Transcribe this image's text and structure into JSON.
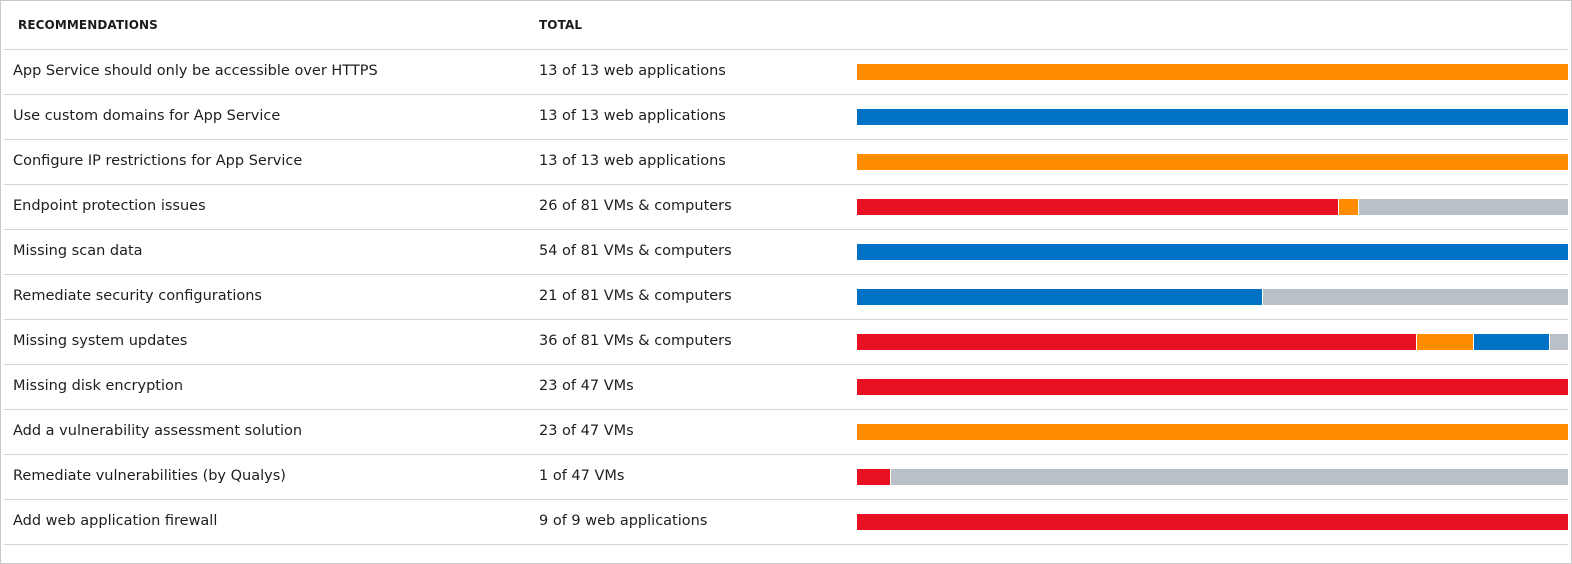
{
  "colors": {
    "high": "#e81123",
    "medium": "#ff8c00",
    "low": "#0072c6",
    "healthy": "#bac0c7"
  },
  "header": {
    "recommendations": "RECOMMENDATIONS",
    "total": "TOTAL"
  },
  "rows": [
    {
      "name": "App Service should only be accessible over HTTPS",
      "total": "13 of 13 web applications",
      "bar": [
        {
          "color": "medium",
          "fraction": 1.0
        }
      ]
    },
    {
      "name": "Use custom domains for App Service",
      "total": "13 of 13 web applications",
      "bar": [
        {
          "color": "low",
          "fraction": 1.0
        }
      ]
    },
    {
      "name": "Configure IP restrictions for App Service",
      "total": "13 of 13 web applications",
      "bar": [
        {
          "color": "medium",
          "fraction": 1.0
        }
      ]
    },
    {
      "name": "Endpoint protection issues",
      "total": "26 of 81 VMs & computers",
      "bar": [
        {
          "color": "high",
          "fraction": 0.676
        },
        {
          "color": "medium",
          "fraction": 0.028
        },
        {
          "color": "healthy",
          "fraction": 0.296
        }
      ]
    },
    {
      "name": "Missing scan data",
      "total": "54 of 81 VMs & computers",
      "bar": [
        {
          "color": "low",
          "fraction": 1.0
        }
      ]
    },
    {
      "name": "Remediate security configurations",
      "total": "21 of 81 VMs & computers",
      "bar": [
        {
          "color": "low",
          "fraction": 0.569
        },
        {
          "color": "healthy",
          "fraction": 0.431
        }
      ]
    },
    {
      "name": "Missing system updates",
      "total": "36 of 81 VMs & computers",
      "bar": [
        {
          "color": "high",
          "fraction": 0.786
        },
        {
          "color": "medium",
          "fraction": 0.081
        },
        {
          "color": "low",
          "fraction": 0.107
        },
        {
          "color": "healthy",
          "fraction": 0.026
        }
      ]
    },
    {
      "name": "Missing disk encryption",
      "total": "23 of 47 VMs",
      "bar": [
        {
          "color": "high",
          "fraction": 1.0
        }
      ]
    },
    {
      "name": "Add a vulnerability assessment solution",
      "total": "23 of 47 VMs",
      "bar": [
        {
          "color": "medium",
          "fraction": 1.0
        }
      ]
    },
    {
      "name": "Remediate vulnerabilities (by Qualys)",
      "total": "1 of 47 VMs",
      "bar": [
        {
          "color": "high",
          "fraction": 0.046
        },
        {
          "color": "healthy",
          "fraction": 0.954
        }
      ]
    },
    {
      "name": "Add web application firewall",
      "total": "9 of 9 web applications",
      "bar": [
        {
          "color": "high",
          "fraction": 1.0
        }
      ]
    }
  ]
}
